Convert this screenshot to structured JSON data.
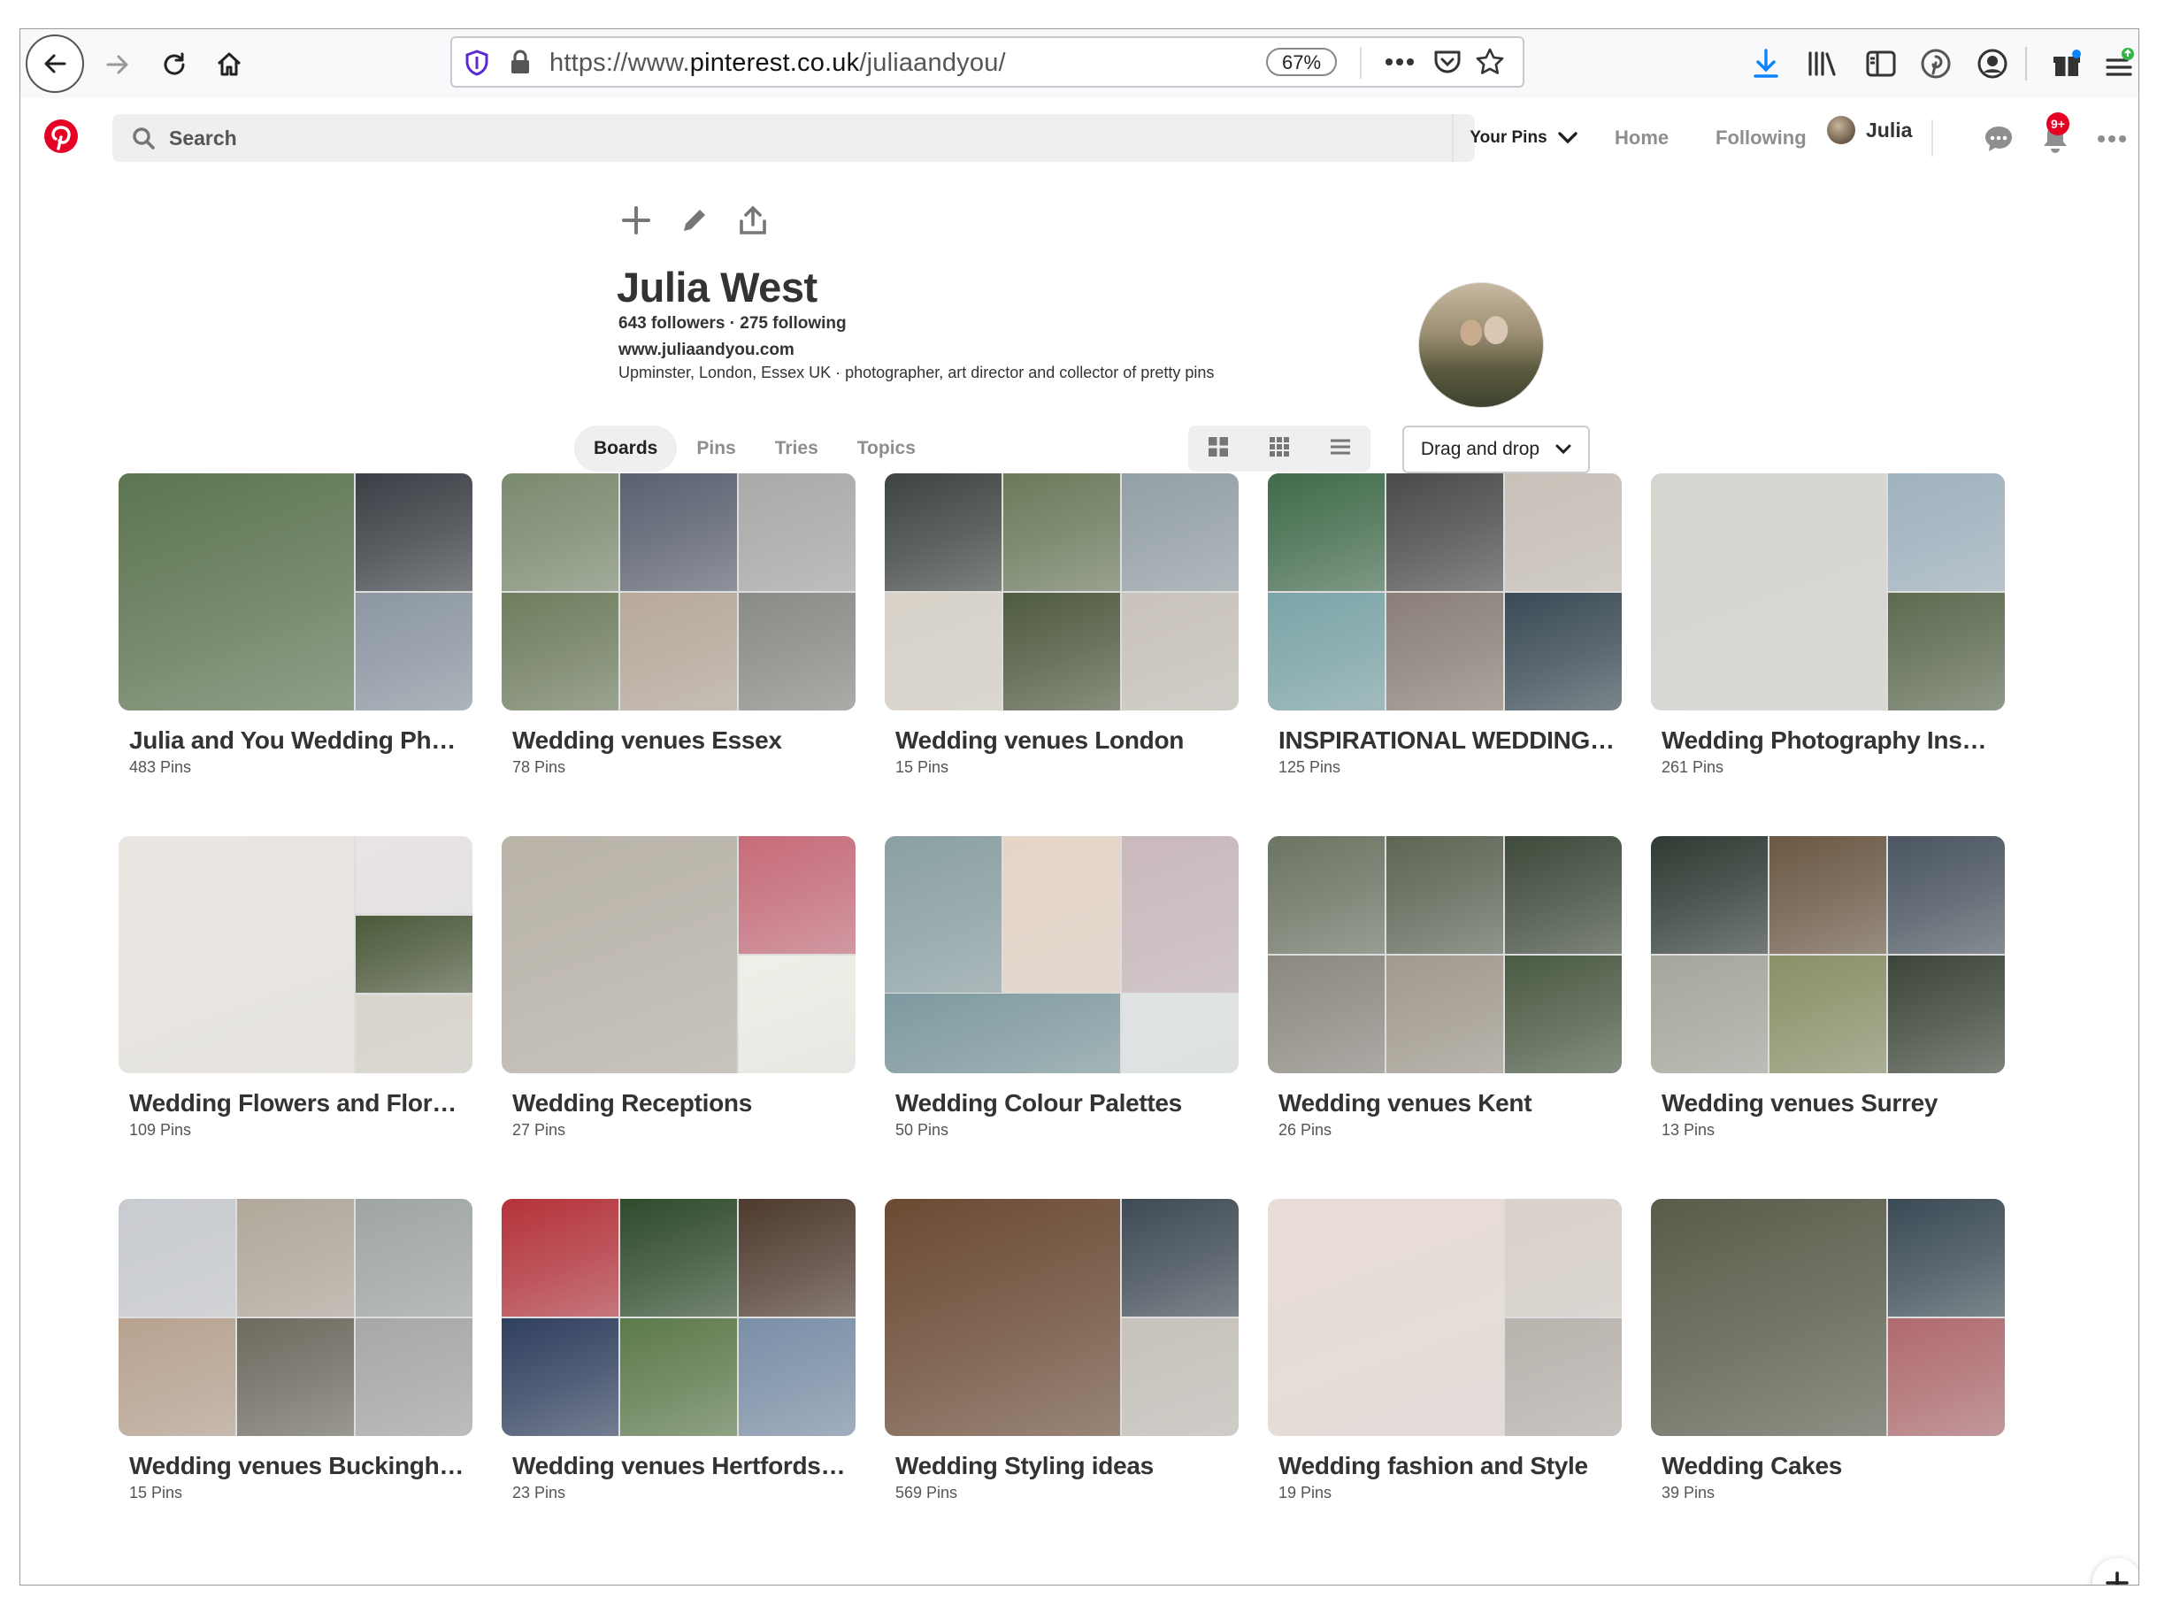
{
  "browser": {
    "url_prefix": "https://www.",
    "url_host": "pinterest.co.uk",
    "url_path": "/juliaandyou/",
    "zoom": "67%"
  },
  "header": {
    "search_placeholder": "Search",
    "your_pins": "Your Pins",
    "home": "Home",
    "following": "Following",
    "user_name": "Julia",
    "notification_count": "9+"
  },
  "profile": {
    "name": "Julia West",
    "stats": "643 followers · 275 following",
    "website": "www.juliaandyou.com",
    "bio": "Upminster, London, Essex UK  ·  photographer, art director and collector of pretty pins"
  },
  "tabs": [
    "Boards",
    "Pins",
    "Tries",
    "Topics"
  ],
  "sort_label": "Drag and drop",
  "boards": [
    {
      "title": "Julia and You Wedding Phot...",
      "count": "483 Pins",
      "colors": [
        "#5d7550",
        "#3a3f45",
        "#8c97a3"
      ]
    },
    {
      "title": "Wedding venues Essex",
      "count": "78 Pins",
      "colors": [
        "#7a8a6e",
        "#5a6070",
        "#a9a9a9",
        "#6f7d5d",
        "#b7a99a",
        "#8a8a86"
      ]
    },
    {
      "title": "Wedding venues London",
      "count": "15 Pins",
      "colors": [
        "#3d4440",
        "#6b7a5a",
        "#93a0a6",
        "#d8d2c8",
        "#4f5b3f",
        "#c9c3bb"
      ]
    },
    {
      "title": "INSPIRATIONAL WEDDING ...",
      "count": "125 Pins",
      "colors": [
        "#3f6b4a",
        "#4a4a4a",
        "#c9c1b8",
        "#7aa5a8",
        "#8a7f78",
        "#3a4a55"
      ]
    },
    {
      "title": "Wedding Photography Inspi...",
      "count": "261 Pins",
      "colors": [
        "#d7d5d0",
        "#9fb2bf",
        "#5d6a4f"
      ]
    },
    {
      "title": "Wedding Flowers and Florals",
      "count": "109 Pins",
      "colors": [
        "#eae6e2",
        "#e9e4e4",
        "#4c5a3a",
        "#d9d4cc"
      ]
    },
    {
      "title": "Wedding Receptions",
      "count": "27 Pins",
      "colors": [
        "#b9b3a8",
        "#c86b7a",
        "#eef0e8"
      ]
    },
    {
      "title": "Wedding Colour Palettes",
      "count": "50 Pins",
      "colors": [
        "#8aa0a3",
        "#e5d5c7",
        "#c9b8bc",
        "#7d9aa0",
        "#dfe3e3"
      ]
    },
    {
      "title": "Wedding venues Kent",
      "count": "26 Pins",
      "colors": [
        "#6b7462",
        "#5d6554",
        "#3e4a3a",
        "#8c8880",
        "#a19a8d",
        "#4a5a43"
      ]
    },
    {
      "title": "Wedding venues Surrey",
      "count": "13 Pins",
      "colors": [
        "#2e3a33",
        "#6b5843",
        "#4a5560",
        "#a5a79c",
        "#8a9066",
        "#3c4537"
      ]
    },
    {
      "title": "Wedding venues Buckingha...",
      "count": "15 Pins",
      "colors": [
        "#c8cbcf",
        "#b1a89b",
        "#9fa5a5",
        "#b8a28f",
        "#6d6b5f",
        "#a7a7a5"
      ]
    },
    {
      "title": "Wedding venues Hertfordsh...",
      "count": "23 Pins",
      "colors": [
        "#b5323a",
        "#2e4a2b",
        "#4e3a2e",
        "#2f3f5f",
        "#5c7a4a",
        "#7a8fa8"
      ]
    },
    {
      "title": "Wedding Styling ideas",
      "count": "569 Pins",
      "colors": [
        "#6b4a33",
        "#3e4a55",
        "#c7c2bb"
      ]
    },
    {
      "title": "Wedding fashion and Style",
      "count": "19 Pins",
      "colors": [
        "#e8dcd6",
        "#d9d1c9",
        "#b9b3ad"
      ]
    },
    {
      "title": "Wedding Cakes",
      "count": "39 Pins",
      "colors": [
        "#5a5c4a",
        "#3a4a55",
        "#b06a6e"
      ]
    }
  ]
}
